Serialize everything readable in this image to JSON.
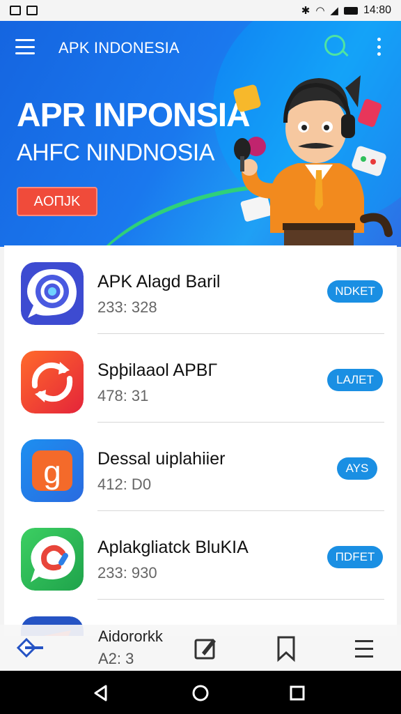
{
  "status_bar": {
    "time": "14:80"
  },
  "header": {
    "title": "APK INDONESIA"
  },
  "banner": {
    "title": "APR INPONSIA",
    "subtitle": "AHFC NINDNOSIA",
    "cta_label": "AOΠJK"
  },
  "apps": [
    {
      "name": "APK Alagd Baril",
      "meta": "233: 328",
      "action": "NDKET"
    },
    {
      "name": "Spþilaaol APBГ",
      "meta": "478: 31",
      "action": "LAЛET"
    },
    {
      "name": "Dessal uiplahiier",
      "meta": "412: D0",
      "action": "AYS"
    },
    {
      "name": "Aplakgliatck  BluKIA",
      "meta": "233: 930",
      "action": "ΠDFET"
    }
  ],
  "bottom_nav": {
    "label": "Aidororkk",
    "meta": "A2: 3"
  },
  "colors": {
    "banner_blue": "#1a78ee",
    "accent_button": "#1a8fe3",
    "cta_red": "#f04b3a",
    "search_green": "#4fe3a3"
  },
  "icons": [
    "menu-icon",
    "search-icon",
    "more-vert-icon",
    "edit-icon",
    "bookmark-icon",
    "list-icon",
    "back-icon",
    "home-icon",
    "recents-icon"
  ]
}
